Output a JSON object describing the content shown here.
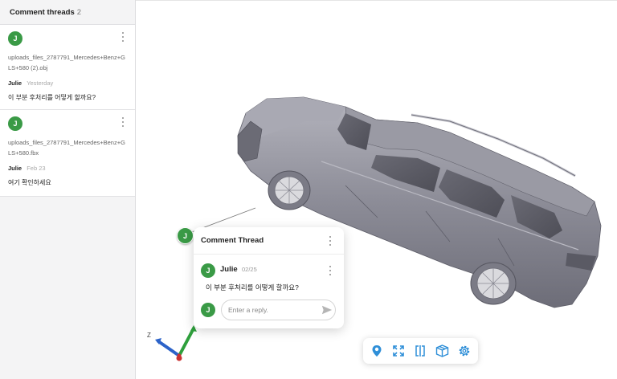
{
  "sidebar": {
    "title": "Comment threads",
    "count": "2",
    "threads": [
      {
        "avatar": "J",
        "file": "uploads_files_2787791_Mercedes+Benz+GLS+580 (2).obj",
        "author": "Julie",
        "date": "Yesterday",
        "message": "이 부분 후처리를 어떻게 할까요?"
      },
      {
        "avatar": "J",
        "file": "uploads_files_2787791_Mercedes+Benz+GLS+580.fbx",
        "author": "Julie",
        "date": "Feb 23",
        "message": "여기 확인하세요"
      }
    ]
  },
  "viewport": {
    "pin_avatar": "J",
    "axis_label": "Z"
  },
  "popup": {
    "title": "Comment Thread",
    "comment": {
      "avatar": "J",
      "author": "Julie",
      "date": "02/25",
      "message": "이 부분 후처리를 어떻게 할까요?"
    },
    "reply": {
      "avatar": "J",
      "placeholder": "Enter a reply."
    }
  },
  "toolbar": {
    "tools": [
      "pin-icon",
      "fit-screen-icon",
      "split-view-icon",
      "box-view-icon",
      "settings-icon"
    ]
  },
  "colors": {
    "avatar": "#3a9a46",
    "toolbar_icon": "#2f8fd8",
    "car_body": "#8e8e99"
  }
}
